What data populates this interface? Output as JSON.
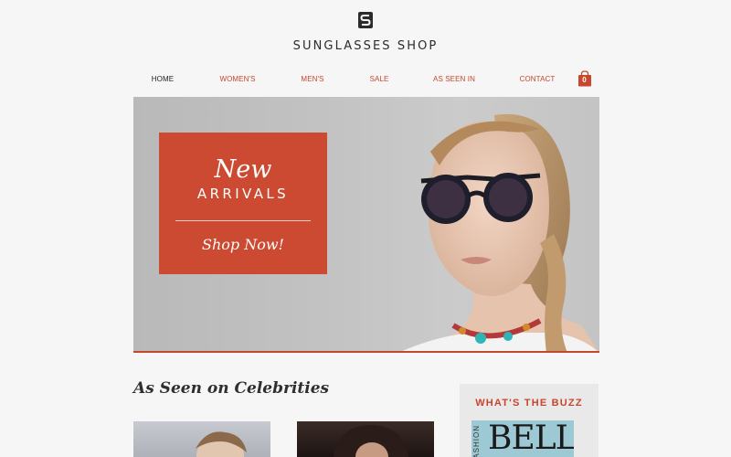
{
  "brand": {
    "name": "SUNGLASSES SHOP"
  },
  "nav": {
    "items": [
      {
        "label": "HOME",
        "active": true
      },
      {
        "label": "WOMEN'S",
        "active": false
      },
      {
        "label": "MEN'S",
        "active": false
      },
      {
        "label": "SALE",
        "active": false
      },
      {
        "label": "AS SEEN IN",
        "active": false
      },
      {
        "label": "CONTACT",
        "active": false
      }
    ],
    "cart_count": "0"
  },
  "hero": {
    "promo_line1": "New",
    "promo_line2": "ARRIVALS",
    "cta": "Shop Now!"
  },
  "celebrities": {
    "title": "As Seen on Celebrities"
  },
  "buzz": {
    "title": "WHAT'S THE BUZZ",
    "magazine_title": "BELLE",
    "magazine_side": "FASHION"
  },
  "colors": {
    "accent": "#c7462d",
    "promo_bg": "#cc4a31",
    "text": "#222222"
  }
}
